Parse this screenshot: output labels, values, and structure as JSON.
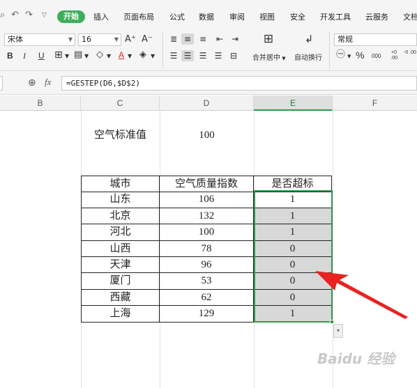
{
  "menu": {
    "items": [
      "开始",
      "插入",
      "页面布局",
      "公式",
      "数据",
      "审阅",
      "视图",
      "安全",
      "开发工具",
      "云服务",
      "文档"
    ]
  },
  "ribbon": {
    "font_name": "宋体",
    "font_size": "16",
    "bold": "B",
    "italic": "I",
    "underline": "U",
    "grow_font": "A⁺",
    "shrink_font": "A⁻",
    "merge_label": "合并居中",
    "wrap_label": "自动换行",
    "number_format": "常规",
    "percent": "%",
    "thousands": "000",
    "inc_decimal": "+0 .00",
    "dec_decimal": "-0 .00"
  },
  "formula_bar": {
    "fx": "fx",
    "formula": "=GESTEP(D6,$D$2)"
  },
  "columns": [
    "B",
    "C",
    "D",
    "E",
    "F"
  ],
  "active_column": "E",
  "sheet": {
    "std_label": "空气标准值",
    "std_value": "100",
    "headers": [
      "城市",
      "空气质量指数",
      "是否超标"
    ],
    "rows": [
      [
        "山东",
        "106",
        "1"
      ],
      [
        "北京",
        "132",
        "1"
      ],
      [
        "河北",
        "100",
        "1"
      ],
      [
        "山西",
        "78",
        "0"
      ],
      [
        "天津",
        "96",
        "0"
      ],
      [
        "厦门",
        "53",
        "0"
      ],
      [
        "西藏",
        "62",
        "0"
      ],
      [
        "上海",
        "129",
        "1"
      ]
    ]
  },
  "watermark": "Baidu 经验",
  "colors": {
    "accent_green": "#3fae5b",
    "selection_border": "#2e9a4a",
    "arrow_red": "#e8231f"
  }
}
